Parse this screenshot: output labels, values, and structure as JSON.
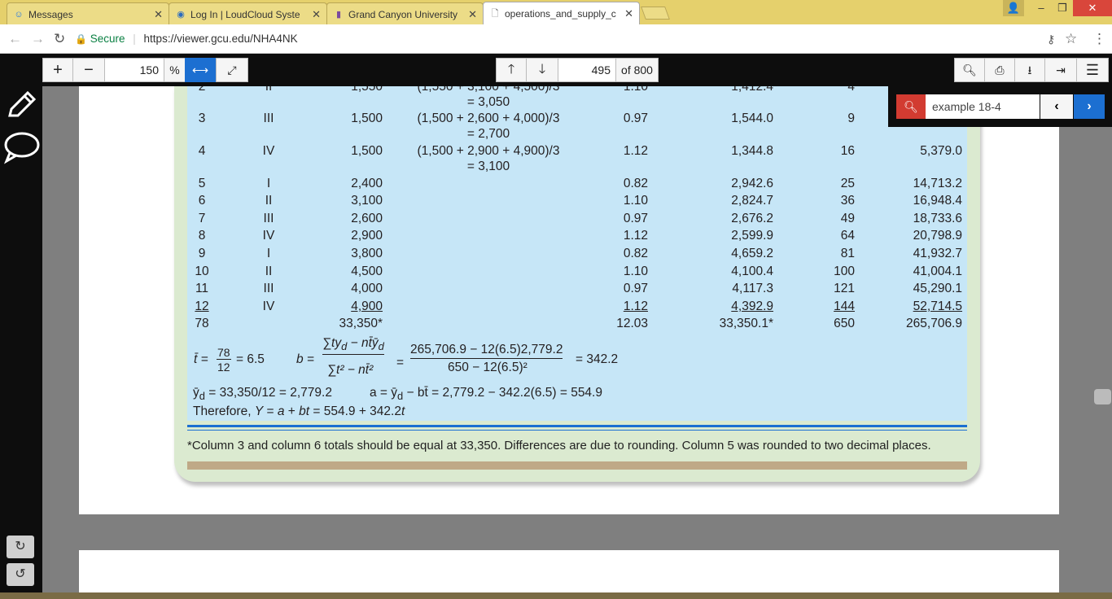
{
  "browser": {
    "tabs": [
      {
        "title": "Messages",
        "icon": "messages-icon"
      },
      {
        "title": "Log In | LoudCloud Syste",
        "icon": "globe-icon"
      },
      {
        "title": "Grand Canyon University",
        "icon": "gcu-icon"
      },
      {
        "title": "operations_and_supply_c",
        "icon": "document-icon"
      }
    ],
    "secure_label": "Secure",
    "url": "https://viewer.gcu.edu/NHA4NK"
  },
  "viewer_toolbar": {
    "zoom_value": "150",
    "zoom_unit": "%",
    "page_value": "495",
    "page_total": "of 800"
  },
  "find": {
    "query": "example 18-4"
  },
  "table": {
    "rows": [
      {
        "period": "2",
        "quarter": "II",
        "actual": "1,550",
        "avg_line1": "(1,550 + 3,100 + 4,500)/3",
        "avg_line2": "= 3,050",
        "factor": "1.10",
        "deseason": "1,412.4",
        "t2": "4",
        "ty": ""
      },
      {
        "period": "3",
        "quarter": "III",
        "actual": "1,500",
        "avg_line1": "(1,500 + 2,600 + 4,000)/3",
        "avg_line2": "= 2,700",
        "factor": "0.97",
        "deseason": "1,544.0",
        "t2": "9",
        "ty": ""
      },
      {
        "period": "4",
        "quarter": "IV",
        "actual": "1,500",
        "avg_line1": "(1,500 + 2,900 + 4,900)/3",
        "avg_line2": "= 3,100",
        "factor": "1.12",
        "deseason": "1,344.8",
        "t2": "16",
        "ty": "5,379.0"
      },
      {
        "period": "5",
        "quarter": "I",
        "actual": "2,400",
        "avg_line1": "",
        "avg_line2": "",
        "factor": "0.82",
        "deseason": "2,942.6",
        "t2": "25",
        "ty": "14,713.2"
      },
      {
        "period": "6",
        "quarter": "II",
        "actual": "3,100",
        "avg_line1": "",
        "avg_line2": "",
        "factor": "1.10",
        "deseason": "2,824.7",
        "t2": "36",
        "ty": "16,948.4"
      },
      {
        "period": "7",
        "quarter": "III",
        "actual": "2,600",
        "avg_line1": "",
        "avg_line2": "",
        "factor": "0.97",
        "deseason": "2,676.2",
        "t2": "49",
        "ty": "18,733.6"
      },
      {
        "period": "8",
        "quarter": "IV",
        "actual": "2,900",
        "avg_line1": "",
        "avg_line2": "",
        "factor": "1.12",
        "deseason": "2,599.9",
        "t2": "64",
        "ty": "20,798.9"
      },
      {
        "period": "9",
        "quarter": "I",
        "actual": "3,800",
        "avg_line1": "",
        "avg_line2": "",
        "factor": "0.82",
        "deseason": "4,659.2",
        "t2": "81",
        "ty": "41,932.7"
      },
      {
        "period": "10",
        "quarter": "II",
        "actual": "4,500",
        "avg_line1": "",
        "avg_line2": "",
        "factor": "1.10",
        "deseason": "4,100.4",
        "t2": "100",
        "ty": "41,004.1"
      },
      {
        "period": "11",
        "quarter": "III",
        "actual": "4,000",
        "avg_line1": "",
        "avg_line2": "",
        "factor": "0.97",
        "deseason": "4,117.3",
        "t2": "121",
        "ty": "45,290.1"
      },
      {
        "period": "12",
        "quarter": "IV",
        "actual": "4,900",
        "avg_line1": "",
        "avg_line2": "",
        "factor": "1.12",
        "deseason": "4,392.9",
        "t2": "144",
        "ty": "52,714.5"
      }
    ],
    "totals": {
      "period": "78",
      "actual": "33,350*",
      "factor": "12.03",
      "deseason": "33,350.1*",
      "t2": "650",
      "ty": "265,706.9"
    }
  },
  "formulas": {
    "tbar_lhs": "t̄ =",
    "tbar_num": "78",
    "tbar_den": "12",
    "tbar_rhs": "= 6.5",
    "b_lhs": "b =",
    "b_num": "∑ty<sub>d</sub> − nt̄ȳ<sub>d</sub>",
    "b_den": "∑t² − nt̄²",
    "b_eq": "=",
    "b_num2": "265,706.9 − 12(6.5)2,779.2",
    "b_den2": "650 − 12(6.5)²",
    "b_rhs": "= 342.2",
    "yd_line": "ȳ<sub>d</sub> = 33,350/12 = 2,779.2",
    "a_line": "a = ȳ<sub>d</sub> − bt̄ = 2,779.2 − 342.2(6.5) = 554.9",
    "therefore_line": "Therefore, <i>Y</i> = <i>a</i> + <i>bt</i> = 554.9 + 342.2<i>t</i>"
  },
  "footnote": "*Column 3 and column 6 totals should be equal at 33,350. Differences are due to rounding. Column 5 was rounded to two decimal places.",
  "colors": {
    "table_bg": "#c6e6f7",
    "panel_bg": "#dbead0",
    "accent_blue": "#1c6fd1",
    "find_red": "#d23b31",
    "tab_bar": "#e5d06c"
  }
}
